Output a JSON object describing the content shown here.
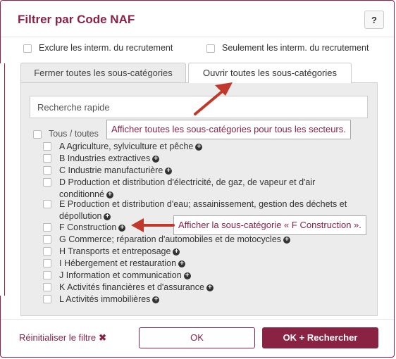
{
  "dialog": {
    "title": "Filtrer par Code NAF",
    "help_label": "?"
  },
  "options": {
    "exclude_label": "Exclure les interm. du recrutement",
    "only_label": "Seulement les interm. du recrutement"
  },
  "tabs": {
    "close_label": "Fermer toutes les sous-catégories",
    "open_label": "Ouvrir toutes les sous-catégories"
  },
  "search": {
    "placeholder": "Recherche rapide"
  },
  "tree": {
    "all_label": "Tous / toutes",
    "items": [
      {
        "label": "A Agriculture, sylviculture et pêche"
      },
      {
        "label": "B Industries extractives"
      },
      {
        "label": "C Industrie manufacturière"
      },
      {
        "label": "D Production et distribution d'électricité, de gaz, de vapeur et d'air conditionné"
      },
      {
        "label": "E Production et distribution d'eau; assainissement, gestion des déchets et dépollution"
      },
      {
        "label": "F Construction"
      },
      {
        "label": "G Commerce; réparation d'automobiles et de motocycles"
      },
      {
        "label": "H Transports et entreposage"
      },
      {
        "label": "I Hébergement et restauration"
      },
      {
        "label": "J Information et communication"
      },
      {
        "label": "K Activités financières et d'assurance"
      },
      {
        "label": "L Activités immobilières"
      }
    ]
  },
  "tooltips": {
    "open_all": "Afficher toutes les sous-catégories pour tous les secteurs.",
    "construction": "Afficher la sous-catégorie « F Construction »."
  },
  "footer": {
    "reset_label": "Réinitialiser le filtre",
    "ok_label": "OK",
    "ok_search_label": "OK + Rechercher"
  },
  "colors": {
    "accent": "#8a2244",
    "arrow": "#c0392b"
  }
}
